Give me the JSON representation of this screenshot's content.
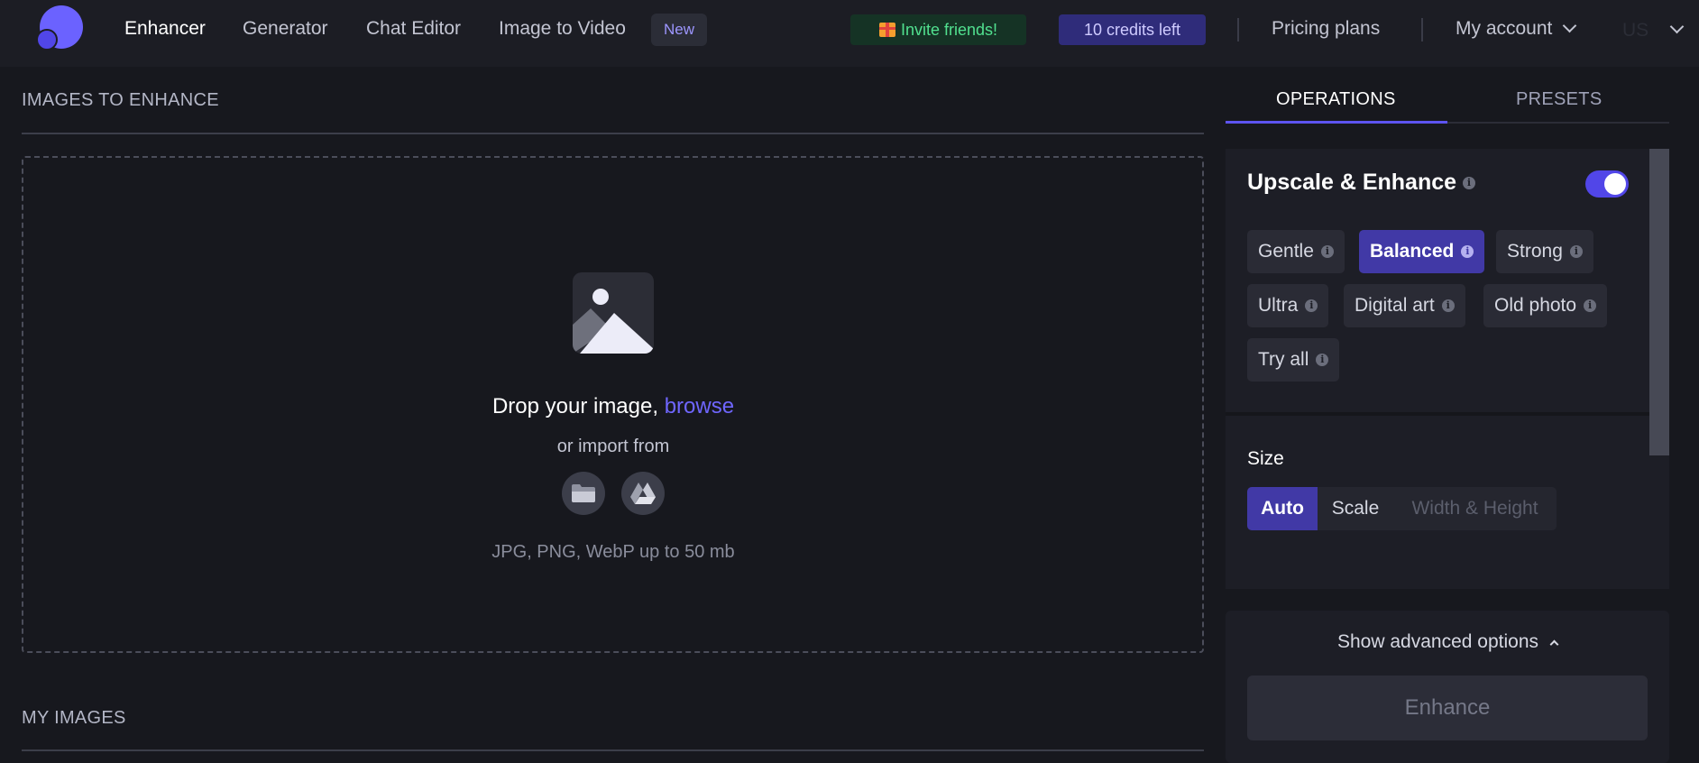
{
  "nav": {
    "links": [
      "Enhancer",
      "Generator",
      "Chat Editor",
      "Image to Video"
    ],
    "new_badge": "New",
    "invite_label": "Invite friends!",
    "credits_label": "10 credits left",
    "pricing_label": "Pricing plans",
    "account_label": "My account",
    "language": "US"
  },
  "upload": {
    "section_title": "IMAGES TO ENHANCE",
    "drop_text": "Drop your image,",
    "browse_label": "browse",
    "import_text": "or import from",
    "formats_text": "JPG, PNG, WebP up to 50 mb"
  },
  "my_images": {
    "section_title": "MY IMAGES"
  },
  "panel": {
    "tabs": [
      "OPERATIONS",
      "PRESETS"
    ],
    "active_tab": "OPERATIONS",
    "upscale": {
      "title": "Upscale & Enhance",
      "enabled": true,
      "modes": [
        "Gentle",
        "Balanced",
        "Strong",
        "Ultra",
        "Digital art",
        "Old photo",
        "Try all"
      ],
      "selected_mode": "Balanced"
    },
    "size": {
      "label": "Size",
      "options": [
        "Auto",
        "Scale",
        "Width & Height"
      ],
      "selected": "Auto"
    },
    "advanced_label": "Show advanced options",
    "enhance_label": "Enhance"
  },
  "colors": {
    "accent": "#5d54f0",
    "background": "#17181e",
    "panel": "#1d1e26",
    "invite_green": "#51e08f",
    "browse_link": "#6f66ff"
  }
}
